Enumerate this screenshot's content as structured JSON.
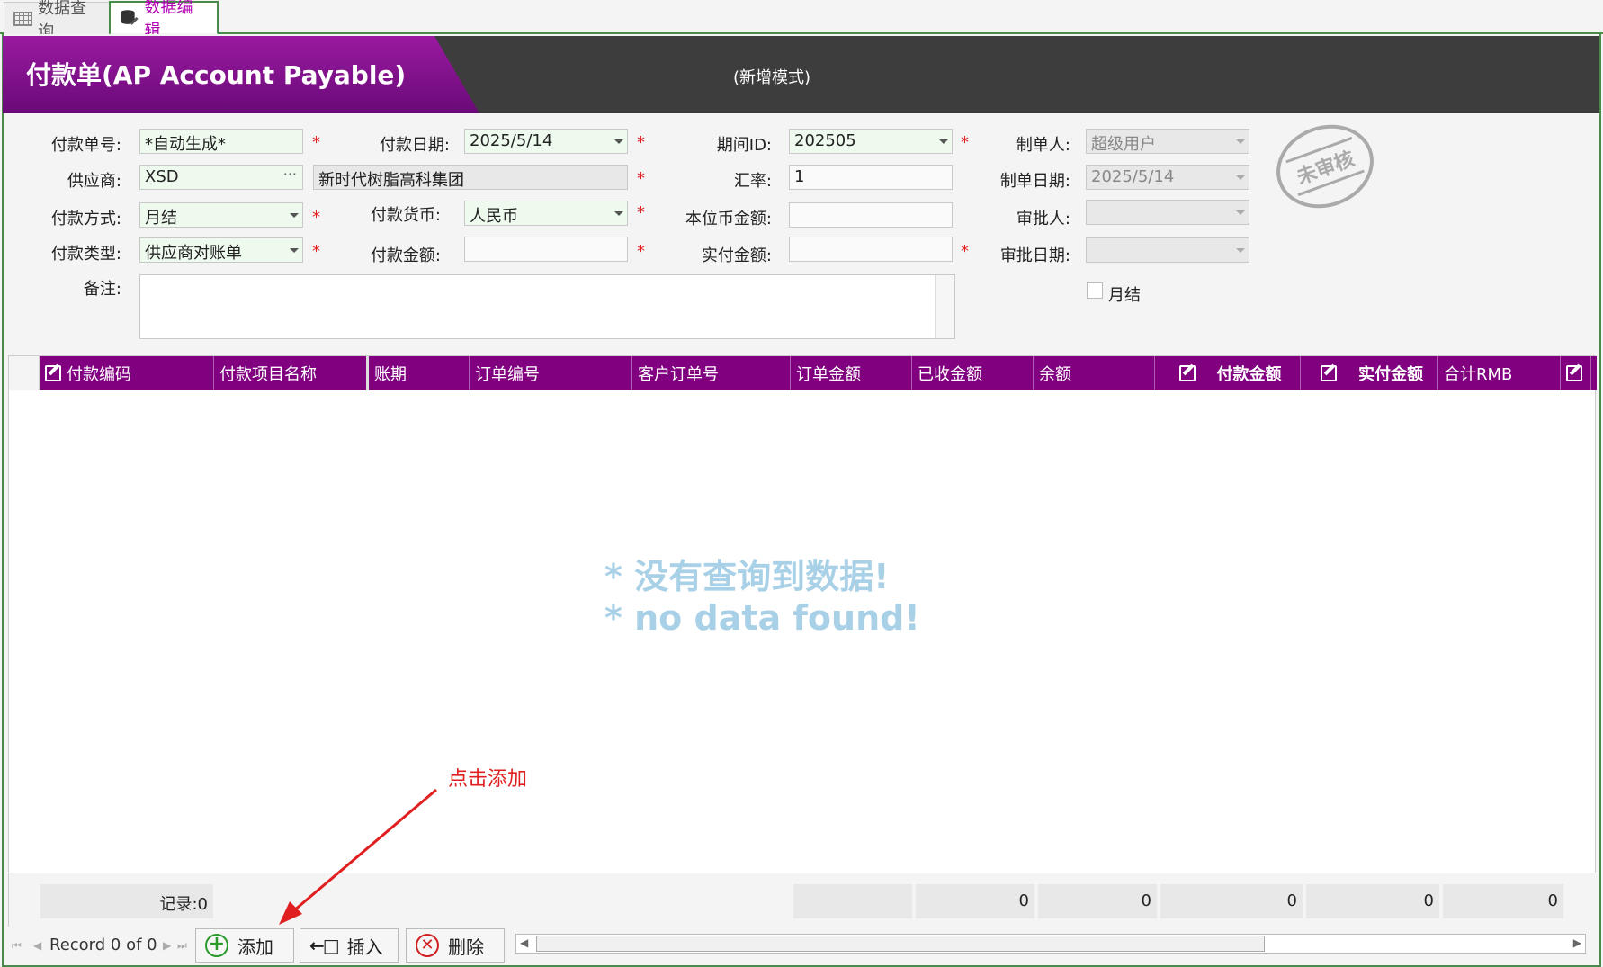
{
  "tabs": [
    {
      "label": "数据查询",
      "icon": "table-grid-icon"
    },
    {
      "label": "数据编辑",
      "icon": "database-edit-icon"
    }
  ],
  "header": {
    "title": "付款单(AP Account Payable)",
    "mode": "(新增模式)"
  },
  "form": {
    "doc_no_label": "付款单号:",
    "doc_no_value": "*自动生成*",
    "pay_date_label": "付款日期:",
    "pay_date_value": "2025/5/14",
    "period_label": "期间ID:",
    "period_value": "202505",
    "maker_label": "制单人:",
    "maker_value": "超级用户",
    "supplier_label": "供应商:",
    "supplier_code": "XSD",
    "supplier_name": "新时代树脂高科集团",
    "rate_label": "汇率:",
    "rate_value": "1",
    "make_date_label": "制单日期:",
    "make_date_value": "2025/5/14",
    "pay_method_label": "付款方式:",
    "pay_method_value": "月结",
    "currency_label": "付款货币:",
    "currency_value": "人民币",
    "local_amount_label": "本位币金额:",
    "local_amount_value": "",
    "approver_label": "审批人:",
    "approver_value": "",
    "pay_type_label": "付款类型:",
    "pay_type_value": "供应商对账单",
    "pay_amount_label": "付款金额:",
    "pay_amount_value": "",
    "actual_amount_label": "实付金额:",
    "actual_amount_value": "",
    "approve_date_label": "审批日期:",
    "approve_date_value": "",
    "remark_label": "备注:",
    "monthly_label": "月结",
    "stamp_text": "未审核",
    "required_mark": "*"
  },
  "grid": {
    "columns": [
      {
        "label": "付款编码",
        "editable": true
      },
      {
        "label": "付款项目名称",
        "editable": false
      },
      {
        "label": "账期",
        "editable": false
      },
      {
        "label": "订单编号",
        "editable": false
      },
      {
        "label": "客户订单号",
        "editable": false
      },
      {
        "label": "订单金额",
        "editable": false
      },
      {
        "label": "已收金额",
        "editable": false
      },
      {
        "label": "余额",
        "editable": false
      },
      {
        "label": "付款金额",
        "editable": true,
        "bold": true
      },
      {
        "label": "实付金额",
        "editable": true,
        "bold": true
      },
      {
        "label": "合计RMB",
        "editable": false
      }
    ],
    "no_data_cn": "* 没有查询到数据!",
    "no_data_en": "* no data found!",
    "summary_count": "记录:0",
    "summary_values": [
      "0",
      "0",
      "0",
      "0",
      "0"
    ]
  },
  "navigator": {
    "record_text": "Record 0 of 0",
    "add_label": "添加",
    "insert_label": "插入",
    "delete_label": "删除"
  },
  "annotation": {
    "text": "点击添加",
    "color": "#e02020"
  },
  "colors": {
    "accent": "#800080",
    "header_bg": "#3d3d3d",
    "required": "#e02020",
    "nodata": "#a8d0e6"
  }
}
